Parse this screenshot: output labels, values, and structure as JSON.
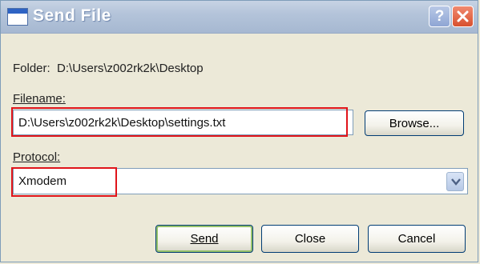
{
  "window": {
    "title": "Send File",
    "help_label": "?"
  },
  "folder": {
    "label": "Folder:",
    "value": "D:\\Users\\z002rk2k\\Desktop"
  },
  "filename": {
    "label": "Filename:",
    "value": "D:\\Users\\z002rk2k\\Desktop\\settings.txt",
    "browse_label": "Browse..."
  },
  "protocol": {
    "label": "Protocol:",
    "selected": "Xmodem"
  },
  "buttons": {
    "send": "Send",
    "close": "Close",
    "cancel": "Cancel"
  },
  "colors": {
    "highlight": "#e0141a",
    "titlebar": "#b4c4da"
  }
}
